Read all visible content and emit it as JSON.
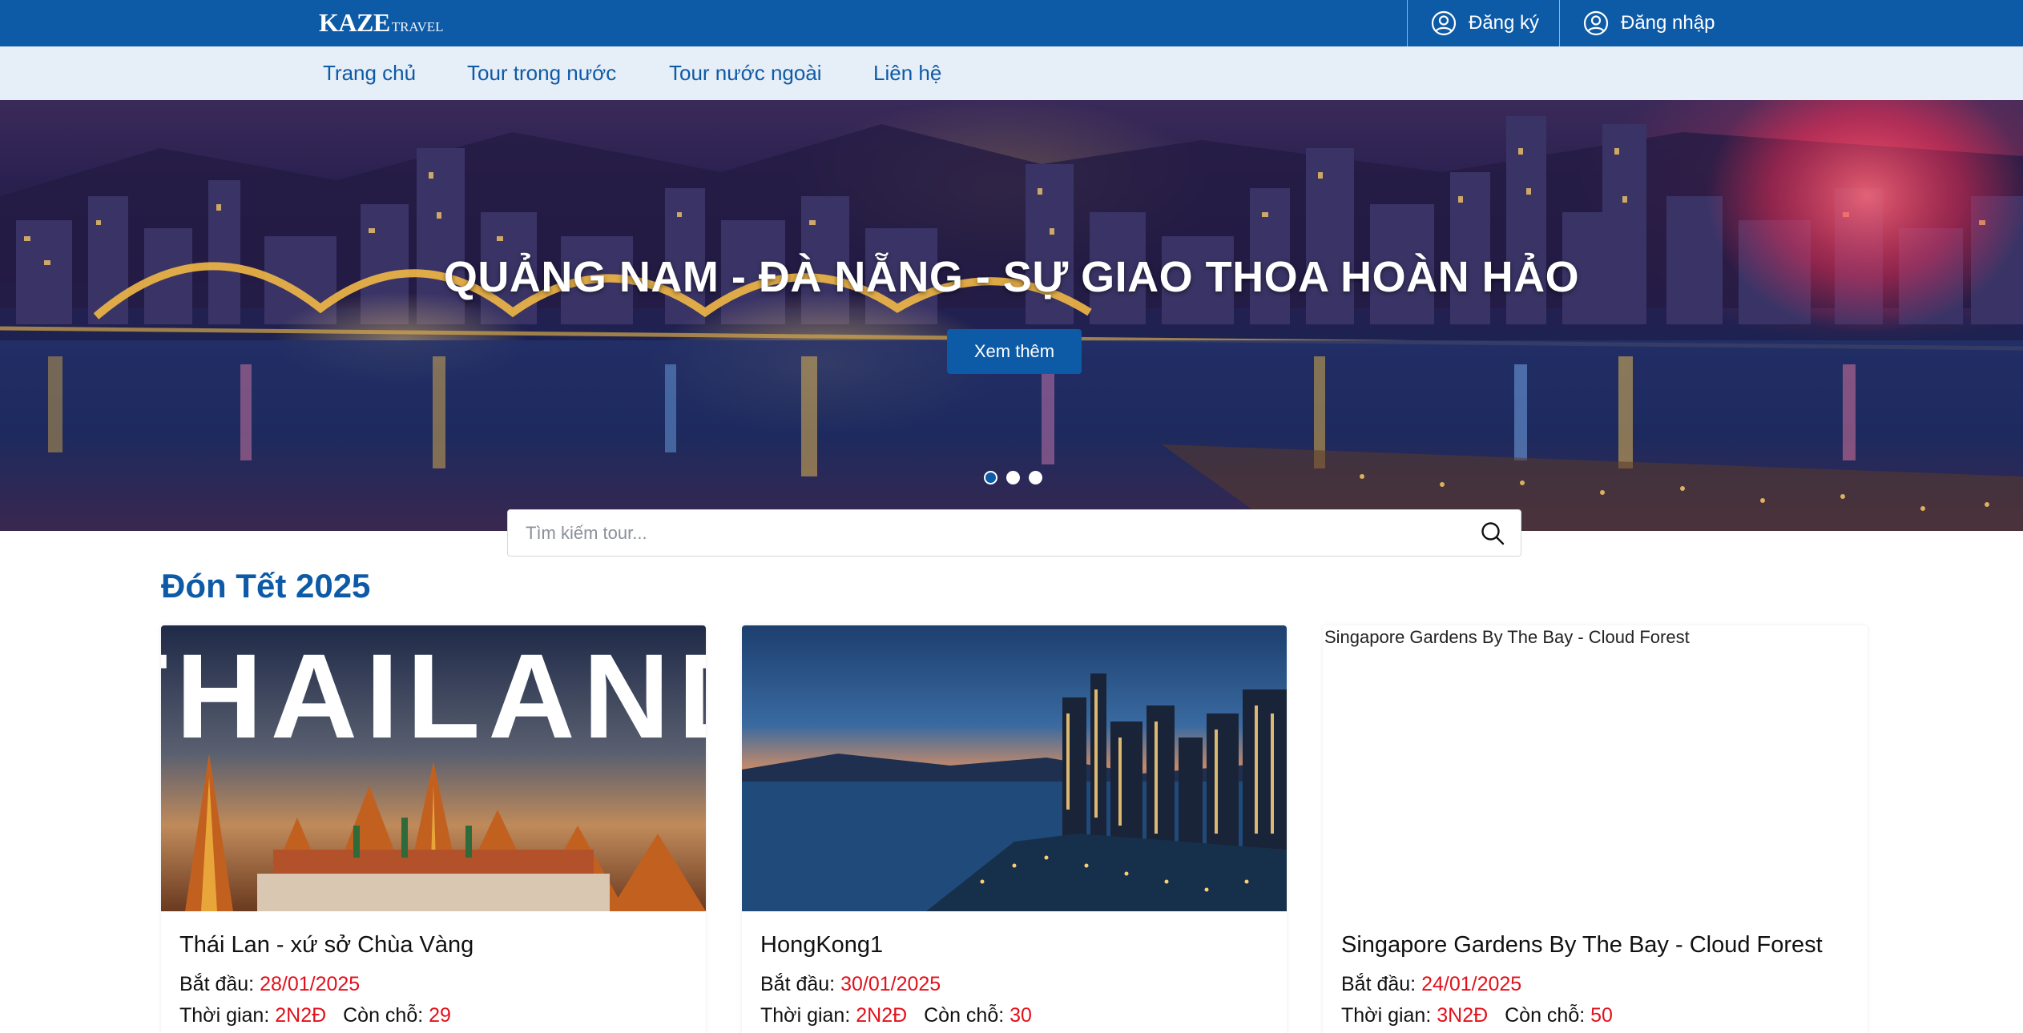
{
  "header": {
    "logo_main": "KAZE",
    "logo_sub": "TRAVEL",
    "register_label": "Đăng ký",
    "login_label": "Đăng nhập",
    "brand_color": "#0d5aa7"
  },
  "nav": {
    "items": [
      {
        "label": "Trang chủ"
      },
      {
        "label": "Tour trong nước"
      },
      {
        "label": "Tour nước ngoài"
      },
      {
        "label": "Liên hệ"
      }
    ]
  },
  "hero": {
    "title": "QUẢNG NAM - ĐÀ NẴNG - SỰ GIAO THOA HOÀN HẢO",
    "button_label": "Xem thêm",
    "slides_count": 3,
    "active_slide": 1
  },
  "search": {
    "placeholder": "Tìm kiếm tour...",
    "icon": "search-icon"
  },
  "section": {
    "title": "Đón Tết 2025"
  },
  "tours": [
    {
      "name": "Thái Lan - xứ sở Chùa Vàng",
      "image_text": "THAILAND",
      "start_label": "Bắt đầu:",
      "start_date": "28/01/2025",
      "duration_label": "Thời gian:",
      "duration": "2N2Đ",
      "seats_label": "Còn chỗ:",
      "seats": "29"
    },
    {
      "name": "HongKong1",
      "start_label": "Bắt đầu:",
      "start_date": "30/01/2025",
      "duration_label": "Thời gian:",
      "duration": "2N2Đ",
      "seats_label": "Còn chỗ:",
      "seats": "30"
    },
    {
      "name": "Singapore Gardens By The Bay - Cloud Forest",
      "image_alt": "Singapore Gardens By The Bay - Cloud Forest",
      "start_label": "Bắt đầu:",
      "start_date": "24/01/2025",
      "duration_label": "Thời gian:",
      "duration": "3N2Đ",
      "seats_label": "Còn chỗ:",
      "seats": "50"
    }
  ]
}
